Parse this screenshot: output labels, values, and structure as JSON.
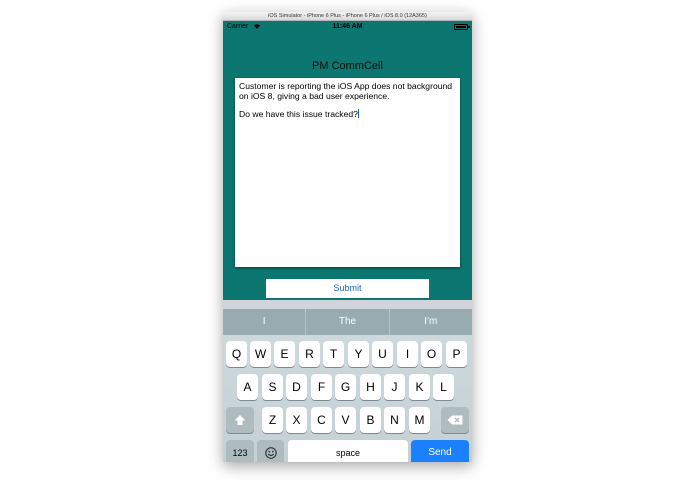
{
  "window": {
    "title": "iOS Simulator - iPhone 6 Plus - iPhone 6 Plus / iOS 8.0 (12A365)"
  },
  "status_bar": {
    "carrier": "Carrier",
    "time": "11:46 AM"
  },
  "app": {
    "title": "PM CommCell",
    "message_para1": "Customer is reporting the iOS App does not background on iOS 8, giving a bad user experience.",
    "message_para2": "Do we have this issue tracked?",
    "submit_label": "Submit"
  },
  "suggestions": [
    "I",
    "The",
    "I'm"
  ],
  "keyboard": {
    "row1": [
      "Q",
      "W",
      "E",
      "R",
      "T",
      "Y",
      "U",
      "I",
      "O",
      "P"
    ],
    "row2": [
      "A",
      "S",
      "D",
      "F",
      "G",
      "H",
      "J",
      "K",
      "L"
    ],
    "row3": [
      "Z",
      "X",
      "C",
      "V",
      "B",
      "N",
      "M"
    ],
    "numbers_label": "123",
    "space_label": "space",
    "send_label": "Send",
    "shift_icon": "shift-arrow-icon",
    "backspace_icon": "backspace-icon",
    "emoji_icon": "emoji-smiley-icon"
  }
}
